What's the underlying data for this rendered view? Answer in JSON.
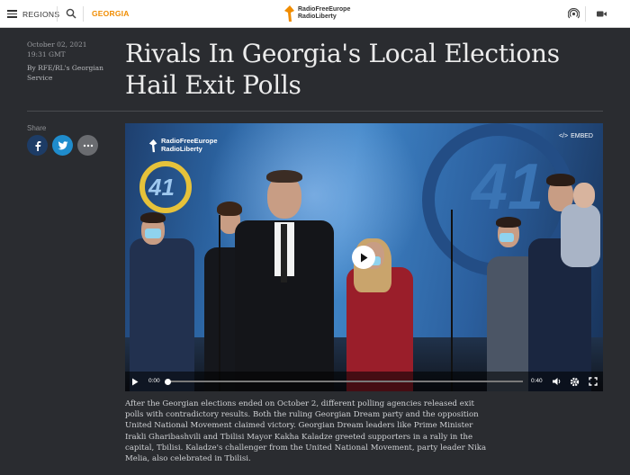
{
  "header": {
    "regions_label": "REGIONS",
    "section_label": "GEORGIA",
    "logo_line1": "RadioFreeEurope",
    "logo_line2": "RadioLiberty",
    "brand_color": "#f08c00"
  },
  "article": {
    "date": "October 02, 2021 19:31 GMT",
    "byline": "By RFE/RL's Georgian Service",
    "title": "Rivals In Georgia's Local Elections Hail Exit Polls",
    "body": "After the Georgian elections ended on October 2, different polling agencies released exit polls with contradictory results. Both the ruling Georgian Dream party and the opposition United National Movement claimed victory. Georgian Dream leaders like Prime Minister Irakli Gharibashvili and Tbilisi Mayor Kakha Kaladze greeted supporters in a rally in the capital, Tbilisi. Kaladze's challenger from the United National Movement, party leader Nika Melia, also celebrated in Tbilisi."
  },
  "share": {
    "label": "Share",
    "buttons": [
      {
        "icon": "facebook-icon",
        "color": "#1d3c66"
      },
      {
        "icon": "twitter-icon",
        "color": "#1f8ccc"
      },
      {
        "icon": "more-icon",
        "color": "#6a6c70"
      }
    ]
  },
  "video": {
    "logo_line1": "RadioFreeEurope",
    "logo_line2": "RadioLiberty",
    "embed_label": "EMBED",
    "stage_number": "41",
    "current_time": "0:00",
    "duration": "0:40",
    "progress": 0
  }
}
